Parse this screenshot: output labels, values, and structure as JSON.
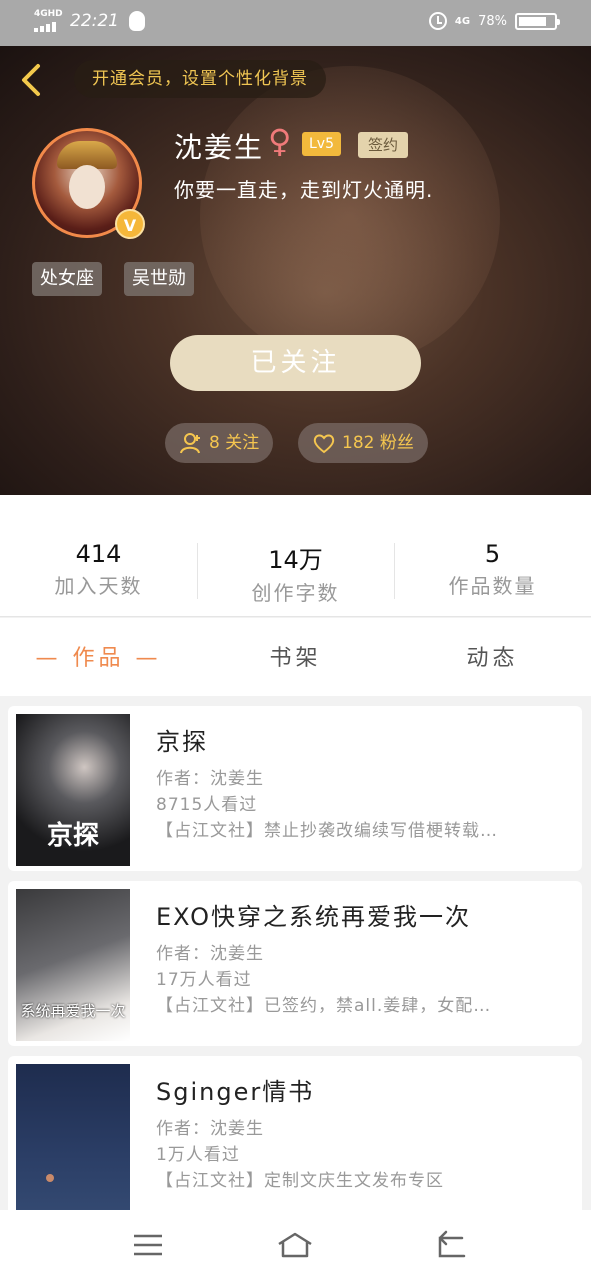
{
  "status_bar": {
    "network_label": "4GHD",
    "time": "22:21",
    "network_right": "4G",
    "battery_percent": "78%",
    "battery_level": 0.78
  },
  "header": {
    "vip_banner": "开通会员，设置个性化背景",
    "username": "沈姜生",
    "gender_symbol": "♀",
    "level": "Lv5",
    "signed_badge": "签约",
    "motto": "你要一直走，走到灯火通明.",
    "avatar_badge": "V",
    "tags": [
      "处女座",
      "吴世勋"
    ],
    "follow_button": "已关注",
    "following_label": "8 关注",
    "fans_label": "182 粉丝"
  },
  "stats": [
    {
      "value": "414",
      "label": "加入天数"
    },
    {
      "value": "14万",
      "label": "创作字数"
    },
    {
      "value": "5",
      "label": "作品数量"
    }
  ],
  "tabs": [
    {
      "label": "— 作品 —",
      "active": true
    },
    {
      "label": "书架",
      "active": false
    },
    {
      "label": "动态",
      "active": false
    }
  ],
  "books": [
    {
      "title": "京探",
      "author": "作者：沈姜生",
      "views": "8715人看过",
      "desc": "【占江文社】禁止抄袭改编续写借梗转载…",
      "cover_text": "京探"
    },
    {
      "title": "EXO快穿之系统再爱我一次",
      "author": "作者：沈姜生",
      "views": "17万人看过",
      "desc": "【占江文社】已签约，禁all.姜肆，女配…",
      "cover_text": "系统再爱我一次"
    },
    {
      "title": "Sginger情书",
      "author": "作者：沈姜生",
      "views": "1万人看过",
      "desc": "【占江文社】定制文庆生文发布专区",
      "cover_text": ""
    }
  ],
  "colors": {
    "accent": "#ef8a4e",
    "vip_gold": "#f0c653",
    "follow_button": "#e8dcc0"
  },
  "nav_icons": [
    "menu-icon",
    "home-icon",
    "back-icon"
  ]
}
